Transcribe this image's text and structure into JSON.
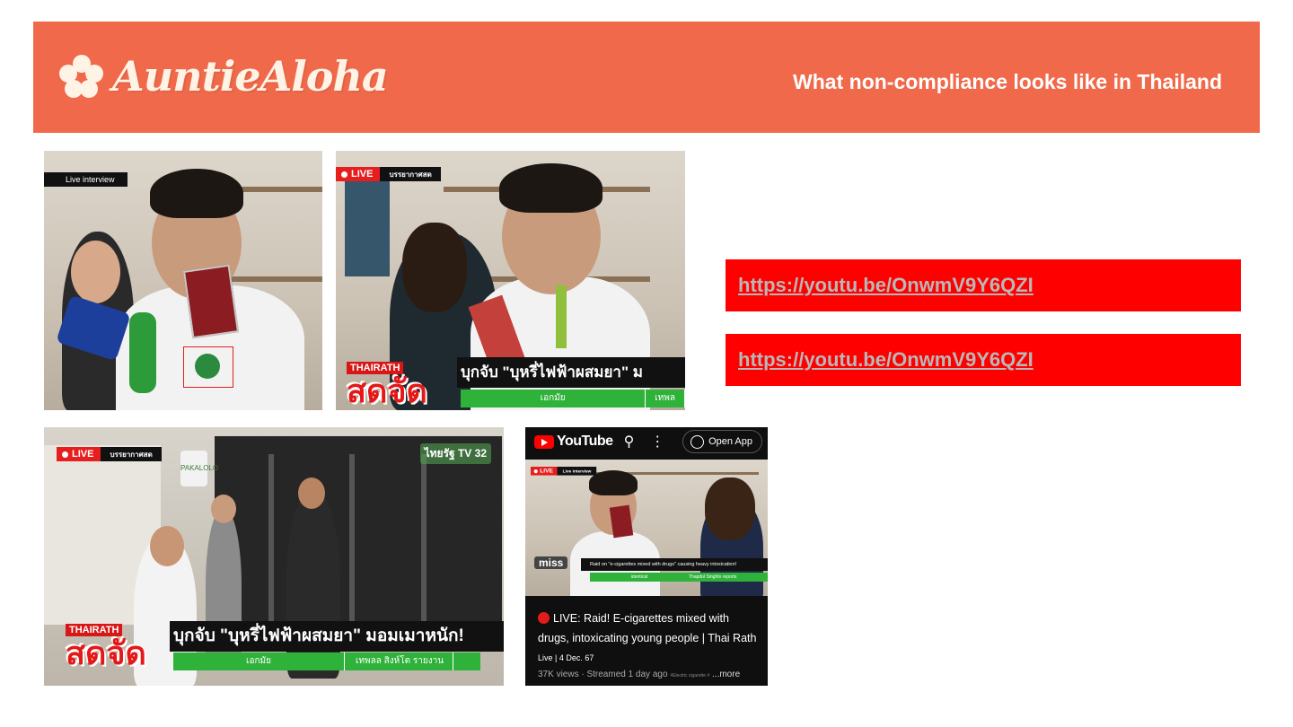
{
  "header": {
    "brand": "AuntieAloha",
    "subtitle": "What non-compliance looks like in Thailand",
    "color": "#f0694a"
  },
  "links": [
    {
      "text": "https://youtu.be/OnwmV9Y6QZI"
    },
    {
      "text": "https://youtu.be/OnwmV9Y6QZI"
    }
  ],
  "thumb1": {
    "tag": "Live interview"
  },
  "thumb2": {
    "live": "LIVE",
    "live_extra": "บรรยากาศสด",
    "brand_top": "THAIRATH",
    "brand_big": "สดจัด",
    "headline": "บุกจับ \"บุหรี่ไฟฟ้าผสมยา\" ม",
    "ticker": [
      "เอกมัย",
      "เทพล"
    ]
  },
  "thumb3": {
    "live": "LIVE",
    "live_extra": "บรรยากาศสด",
    "channel": "ไทยรัฐ TV 32",
    "store_sign": "PAKALOLO",
    "brand_top": "THAIRATH",
    "brand_big": "สดจัด",
    "headline": "บุกจับ \"บุหรี่ไฟฟ้าผสมยา\" มอมเมาหนัก!",
    "ticker": [
      "เอกมัย",
      "เทพลล สิงห์โต  รายงาน"
    ]
  },
  "youtube": {
    "logo": "YouTube",
    "open_app": "Open App",
    "inner_banner": "Raid on \"e-cigarettes mixed with drugs\" causing heavy intoxication!",
    "inner_ticker": [
      "identical",
      "Thapdol Singhto reports"
    ],
    "inner_brand": "miss",
    "title": "LIVE: Raid! E-cigarettes mixed with drugs, intoxicating young people | Thai Rath",
    "subtitle": "Live | 4 Dec. 67",
    "meta": "37K views · Streamed 1 day ago",
    "hashtag": "#Electric cigarette #",
    "more": "...more"
  }
}
